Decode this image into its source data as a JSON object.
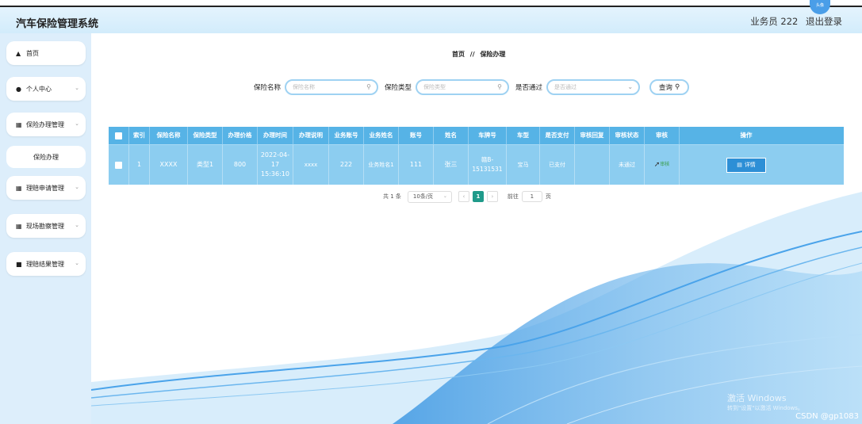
{
  "app": {
    "title": "汽车保险管理系统"
  },
  "user": {
    "role_label": "业务员 222",
    "logout": "退出登录",
    "avatar_text": "头像"
  },
  "sidebar": {
    "items": [
      {
        "icon": "home-icon",
        "label": "首页"
      },
      {
        "icon": "user-icon",
        "label": "个人中心"
      },
      {
        "icon": "grid-icon",
        "label": "保险办理管理"
      },
      {
        "icon": "table-icon",
        "label": "理赔申请管理"
      },
      {
        "icon": "grid-icon",
        "label": "现场勘察管理"
      },
      {
        "icon": "folder-icon",
        "label": "理赔结果管理"
      }
    ],
    "sub_item": "保险办理"
  },
  "breadcrumb": {
    "home": "首页",
    "sep": "//",
    "current": "保险办理"
  },
  "search": {
    "name_label": "保险名称",
    "name_placeholder": "保险名称",
    "type_label": "保险类型",
    "type_placeholder": "保险类型",
    "pass_label": "是否通过",
    "pass_placeholder": "是否通过",
    "query_label": "查询"
  },
  "table": {
    "headers": [
      "索引",
      "保险名称",
      "保险类型",
      "办理价格",
      "办理时间",
      "办理说明",
      "业务账号",
      "业务姓名",
      "账号",
      "姓名",
      "车牌号",
      "车型",
      "是否支付",
      "审核回复",
      "审核状态",
      "审核",
      "操作"
    ],
    "row": {
      "index": "1",
      "name": "XXXX",
      "type": "类型1",
      "price": "800",
      "time": "2022-04-17 15:36:10",
      "note": "xxxx",
      "biz_account": "222",
      "biz_name": "业务姓名1",
      "account": "111",
      "person": "张三",
      "plate": "赣B-15131531",
      "model": "宝马",
      "paid": "已支付",
      "reply": "",
      "status": "未通过",
      "audit_label": "审核",
      "detail_label": "详情"
    }
  },
  "pager": {
    "total": "共 1 条",
    "size": "10条/页",
    "current": "1",
    "goto": "前往",
    "goto_value": "1",
    "page_unit": "页"
  },
  "overlay": {
    "windows_line1": "激活 Windows",
    "windows_line2": "转到\"设置\"以激活 Windows。",
    "csdn": "CSDN @gp1083"
  }
}
